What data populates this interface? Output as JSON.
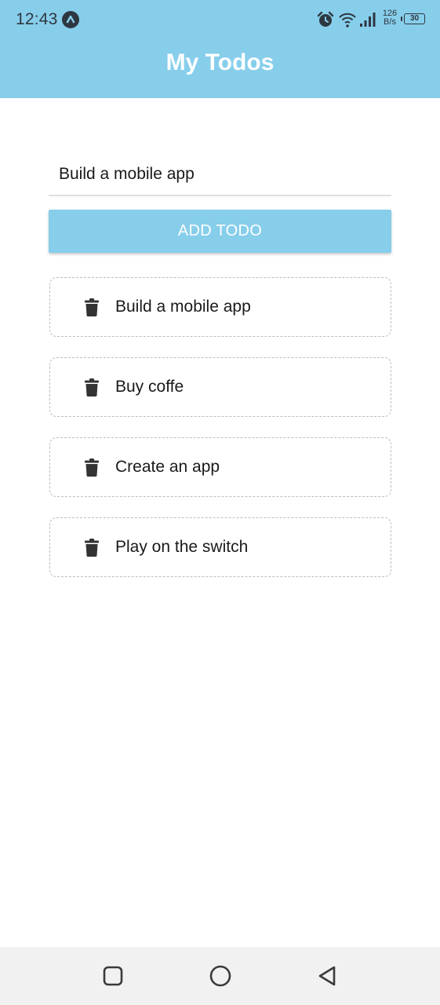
{
  "status_bar": {
    "time": "12:43",
    "net_speed_value": "126",
    "net_speed_unit": "B/s",
    "battery": "30",
    "icons": [
      "app-notification-icon",
      "alarm-icon",
      "wifi-icon",
      "signal-icon",
      "battery-icon"
    ]
  },
  "header": {
    "title": "My Todos",
    "background_color": "#87ceeb"
  },
  "form": {
    "input_value": "Build a mobile app",
    "button_label": "ADD TODO"
  },
  "todos": [
    {
      "text": "Build a mobile app",
      "icon": "trash-icon"
    },
    {
      "text": "Buy coffe",
      "icon": "trash-icon"
    },
    {
      "text": "Create an app",
      "icon": "trash-icon"
    },
    {
      "text": "Play on the switch",
      "icon": "trash-icon"
    }
  ],
  "nav_bar": {
    "icons": [
      "recents-icon",
      "home-icon",
      "back-icon"
    ]
  }
}
